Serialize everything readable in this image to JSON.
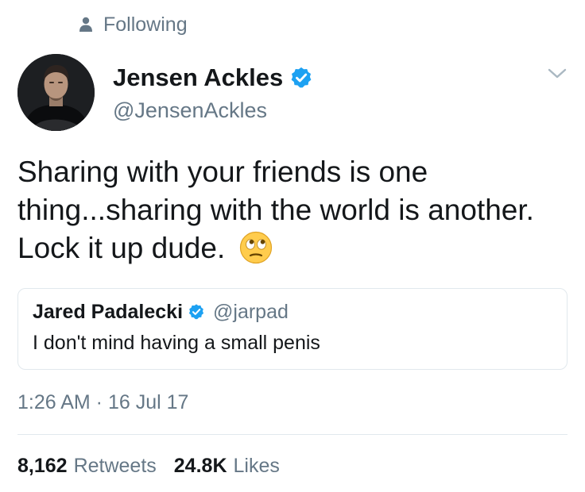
{
  "header": {
    "status_label": "Following",
    "status_icon": "person-icon"
  },
  "author": {
    "display_name": "Jensen Ackles",
    "handle": "@JensenAckles",
    "verified_icon": "verified-badge-icon",
    "avatar": "profile photo"
  },
  "tweet": {
    "text": "Sharing with your friends is one thing...sharing with the world is another.  Lock it up dude.",
    "emoji": "rolling-eyes-face-emoji"
  },
  "quoted_tweet": {
    "display_name": "Jared Padalecki",
    "handle": "@jarpad",
    "text": "I don't mind having a small penis",
    "verified_icon": "verified-badge-icon"
  },
  "meta": {
    "timestamp": "1:26 AM · 16 Jul 17"
  },
  "stats": {
    "retweets_value": "8,162",
    "retweets_label": "Retweets",
    "likes_value": "24.8K",
    "likes_label": "Likes"
  },
  "colors": {
    "text_primary": "#14171a",
    "text_secondary": "#657786",
    "verified_blue": "#1da1f2",
    "border": "#e1e8ed"
  }
}
